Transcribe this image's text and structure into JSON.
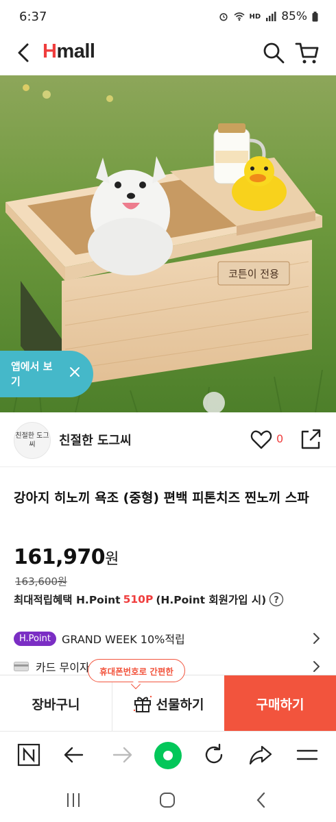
{
  "status_bar": {
    "time": "6:37",
    "network": "HD",
    "battery": "85%"
  },
  "header": {
    "logo_h": "H",
    "logo_rest": "mall"
  },
  "hero": {
    "box_sign": "코튼이 전용",
    "app_banner_label": "앱에서 보기"
  },
  "seller": {
    "avatar_text": "친절한 도그씨",
    "name": "친절한 도그씨",
    "like_count": "0"
  },
  "product": {
    "title": "강아지 히노끼 욕조 (중형) 편백 피톤치즈 찐노끼 스파",
    "price": "161,970",
    "price_unit": "원",
    "original_price": "163,600원",
    "points_prefix": "최대적립혜택 H.Point",
    "points_value": "510P",
    "points_suffix": "(H.Point 회원가입 시)"
  },
  "benefits": [
    {
      "badge": "H.Point",
      "text": "GRAND WEEK 10%적립"
    },
    {
      "text": "카드 무이자"
    }
  ],
  "actions": {
    "cart": "장바구니",
    "gift": "선물하기",
    "buy": "구매하기",
    "tooltip": "휴대폰번호로 간편한"
  },
  "colors": {
    "brand_red": "#ef3d3d",
    "buy_button": "#f2543d",
    "hpoint_purple": "#7b2ec4",
    "app_banner": "#45b8c9",
    "browser_accent": "#03c75a"
  }
}
